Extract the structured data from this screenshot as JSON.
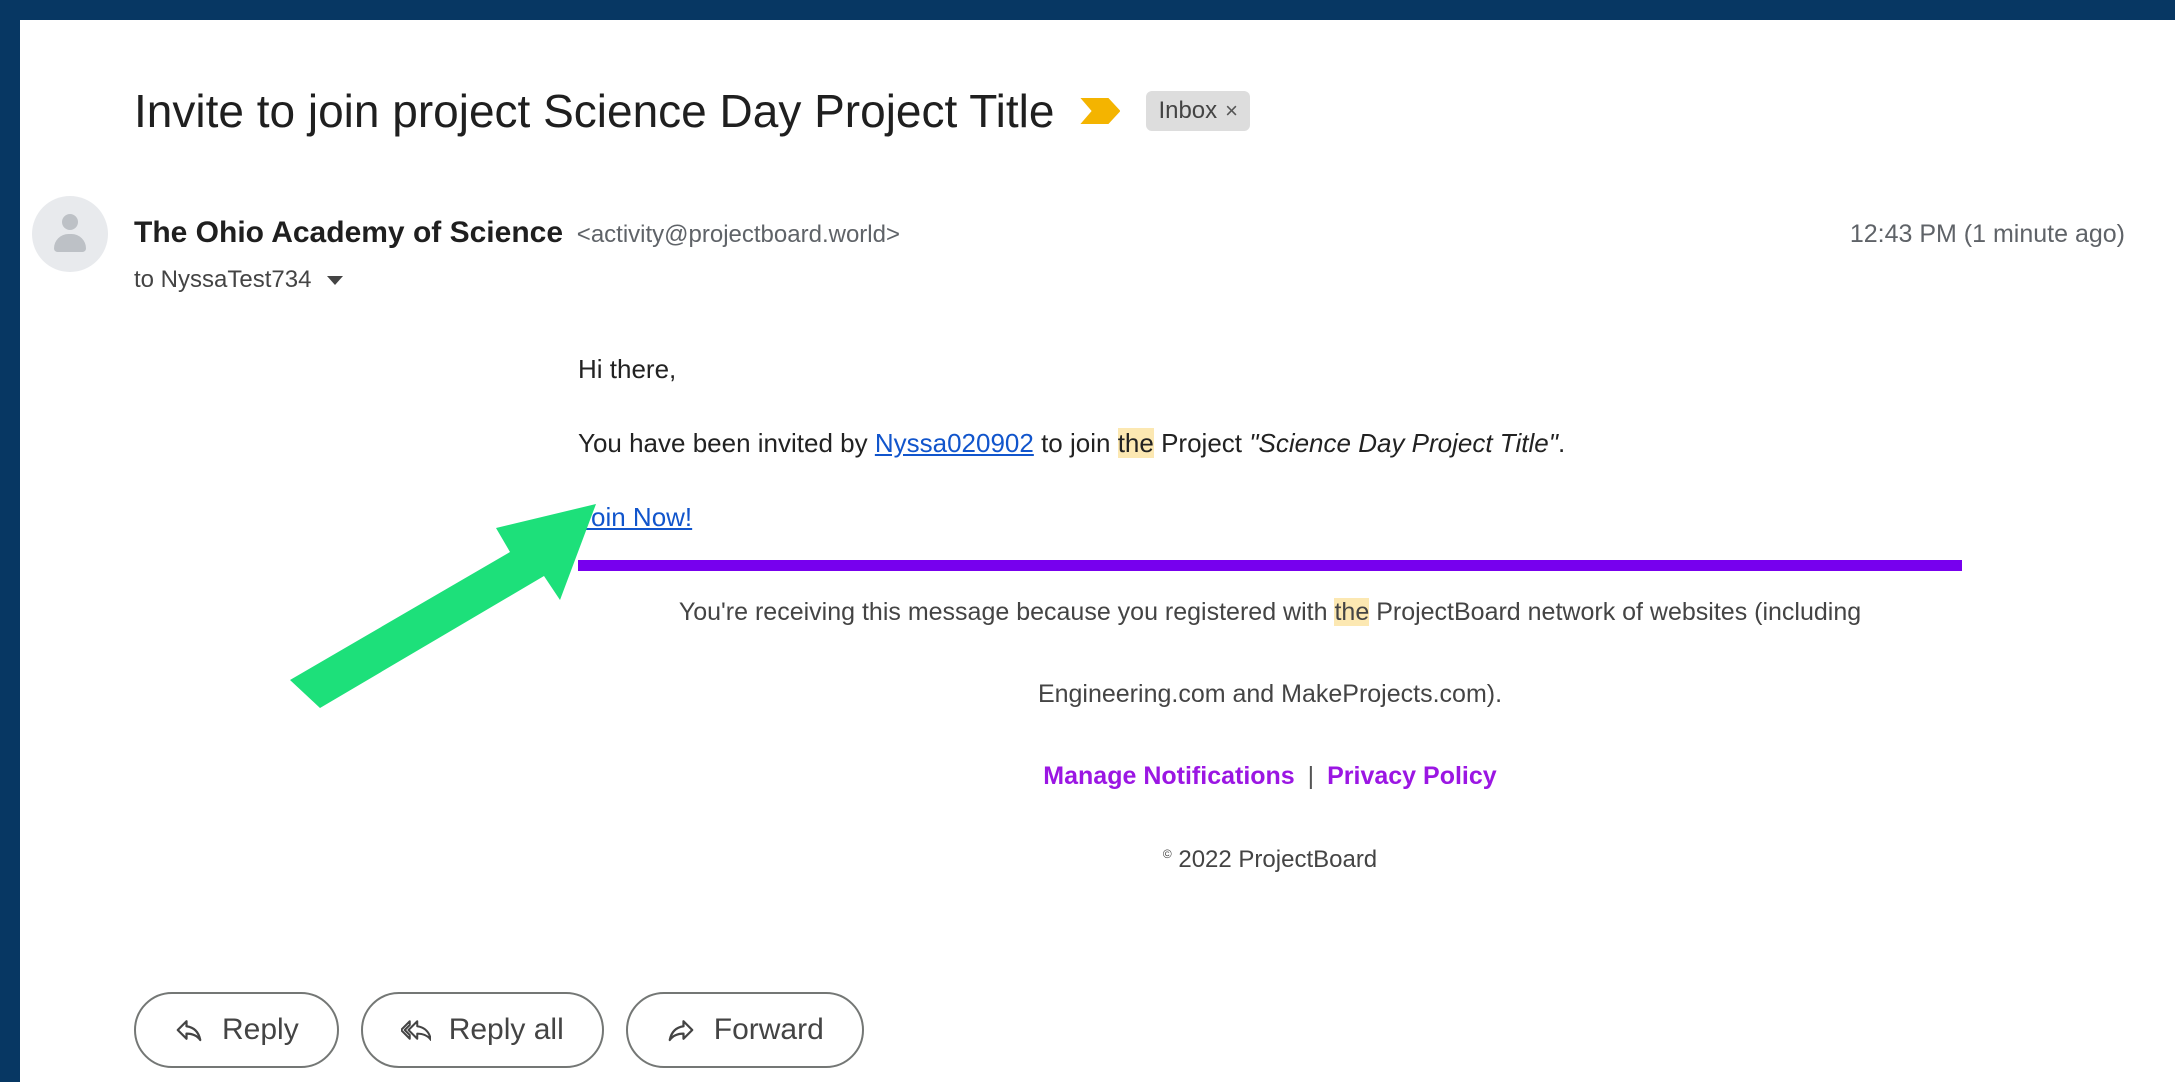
{
  "email": {
    "subject": "Invite to join project Science Day Project Title",
    "label_chip": "Inbox",
    "label_remove": "×",
    "sender_name": "The Ohio Academy of Science",
    "sender_email": "<activity@projectboard.world>",
    "recipient": "to NyssaTest734",
    "timestamp": "12:43 PM (1 minute ago)"
  },
  "message": {
    "greeting": "Hi there,",
    "invite_prefix": "You have been invited by",
    "inviter_link": "Nyssa020902",
    "invite_mid": "to join",
    "highlight_word": "the",
    "invite_project_word": "Project",
    "project_title": "\"Science Day Project Title\"",
    "invite_end": ".",
    "join_link": "Join Now!"
  },
  "footer": {
    "line1_prefix": "You're receiving this message because you registered with",
    "line1_highlight": "the",
    "line1_suffix": "ProjectBoard network of websites (including",
    "line2": "Engineering.com and MakeProjects.com).",
    "manage_link": "Manage Notifications",
    "separator": "|",
    "privacy_link": "Privacy Policy",
    "copyright_symbol": "©",
    "copyright_text": "2022 ProjectBoard"
  },
  "actions": {
    "reply": "Reply",
    "reply_all": "Reply all",
    "forward": "Forward"
  },
  "colors": {
    "border": "#073763",
    "divider": "#7700ee",
    "footer_link": "#9b16e3",
    "annotation_arrow": "#1de07a",
    "importance_marker": "#f4b400",
    "link": "#1155cc"
  },
  "icons": {
    "importance": "importance-marker-icon",
    "avatar": "avatar-icon",
    "dropdown": "caret-down-icon",
    "reply": "reply-icon",
    "reply_all": "reply-all-icon",
    "forward": "forward-icon",
    "annotation": "green-arrow-icon"
  }
}
